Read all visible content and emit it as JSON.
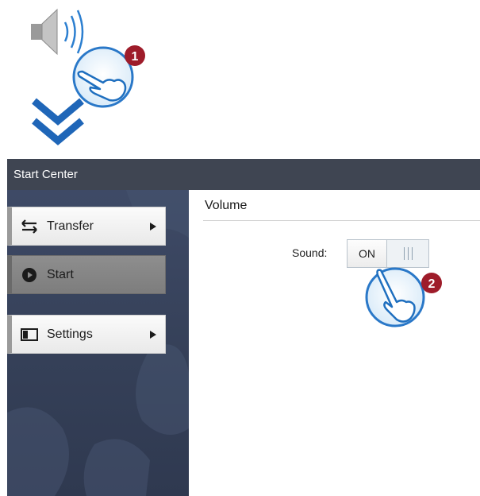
{
  "illustration": {
    "step1_badge": "1",
    "step2_badge": "2",
    "icons": [
      "speaker-icon",
      "hand-pointer-icon",
      "double-chevron-down-icon"
    ]
  },
  "window": {
    "title": "Start Center"
  },
  "sidebar": {
    "items": [
      {
        "label": "Transfer",
        "icon": "transfer-arrows-icon",
        "has_submenu": true,
        "active": false
      },
      {
        "label": "Start",
        "icon": "play-circle-icon",
        "has_submenu": false,
        "active": true
      },
      {
        "label": "Settings",
        "icon": "settings-panel-icon",
        "has_submenu": true,
        "active": false
      }
    ]
  },
  "main": {
    "section_title": "Volume",
    "sound_label": "Sound:",
    "sound_toggle": {
      "state": "ON"
    }
  },
  "colors": {
    "accent_blue": "#1f6fbf",
    "badge_red": "#9e1c2a",
    "titlebar": "#3f4552",
    "sidebar": "#38435c"
  }
}
